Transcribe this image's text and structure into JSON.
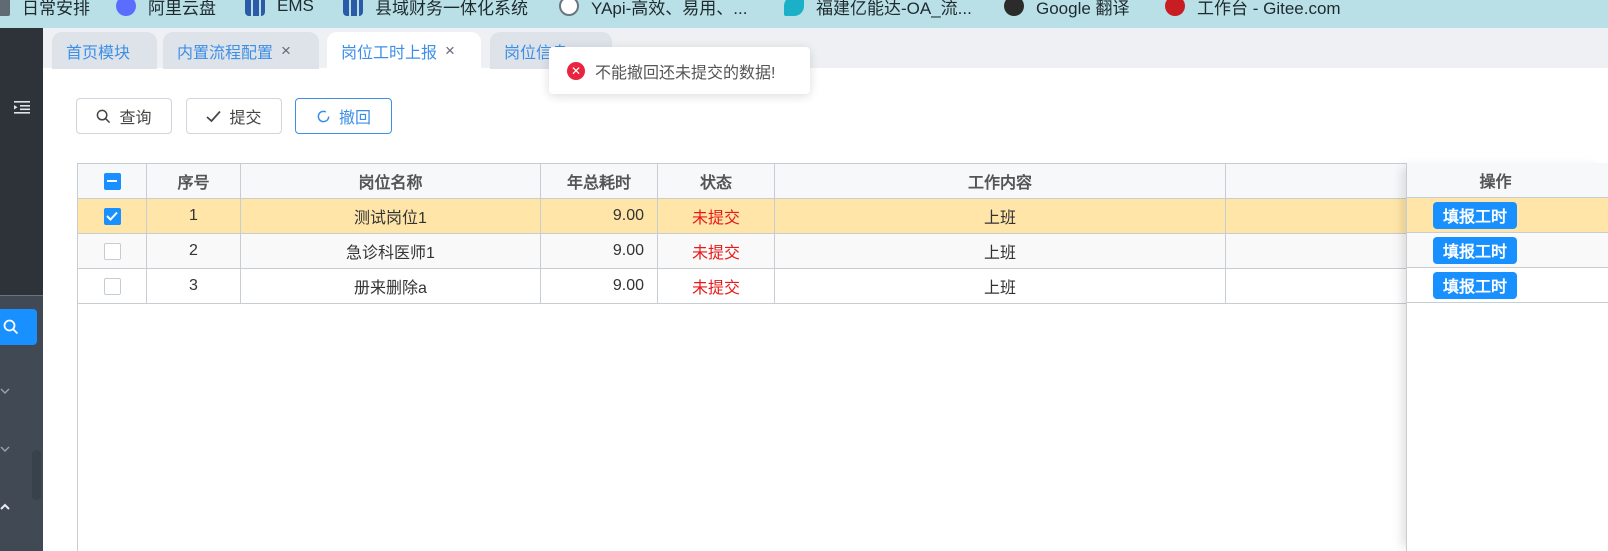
{
  "bookmarks": [
    {
      "label": "日常安排",
      "icon": "folder-icon"
    },
    {
      "label": "阿里云盘",
      "icon": "cloud-icon"
    },
    {
      "label": "EMS",
      "icon": "ems-icon"
    },
    {
      "label": "县域财务一体化系统",
      "icon": "finance-icon"
    },
    {
      "label": "YApi-高效、易用、...",
      "icon": "yapi-icon"
    },
    {
      "label": "福建亿能达-OA_流...",
      "icon": "oa-icon"
    },
    {
      "label": "Google 翻译",
      "icon": "google-translate-icon"
    },
    {
      "label": "工作台 - Gitee.com",
      "icon": "gitee-icon"
    }
  ],
  "tabs": [
    {
      "label": "首页模块",
      "closable": false
    },
    {
      "label": "内置流程配置",
      "closable": true,
      "close": "×"
    },
    {
      "label": "岗位工时上报",
      "closable": true,
      "close": "×",
      "active": true
    },
    {
      "label": "岗位信息",
      "closable": false
    }
  ],
  "toolbar": {
    "query": "查询",
    "submit": "提交",
    "revoke": "撤回"
  },
  "toast": {
    "type": "error",
    "message": "不能撤回还未提交的数据!"
  },
  "table": {
    "headers": {
      "no": "序号",
      "name": "岗位名称",
      "hours": "年总耗时",
      "status": "状态",
      "content": "工作内容",
      "action": "操作"
    },
    "rows": [
      {
        "no": "1",
        "name": "测试岗位1",
        "hours": "9.00",
        "status": "未提交",
        "content": "上班",
        "action": "填报工时",
        "checked": true
      },
      {
        "no": "2",
        "name": "急诊科医师1",
        "hours": "9.00",
        "status": "未提交",
        "content": "上班",
        "action": "填报工时",
        "checked": false
      },
      {
        "no": "3",
        "name": "册来删除a",
        "hours": "9.00",
        "status": "未提交",
        "content": "上班",
        "action": "填报工时",
        "checked": false
      }
    ]
  },
  "colors": {
    "accent": "#1890ff",
    "selected_row": "#ffe6a8",
    "status_red": "#e81919",
    "sidebar": "#2d3338"
  }
}
